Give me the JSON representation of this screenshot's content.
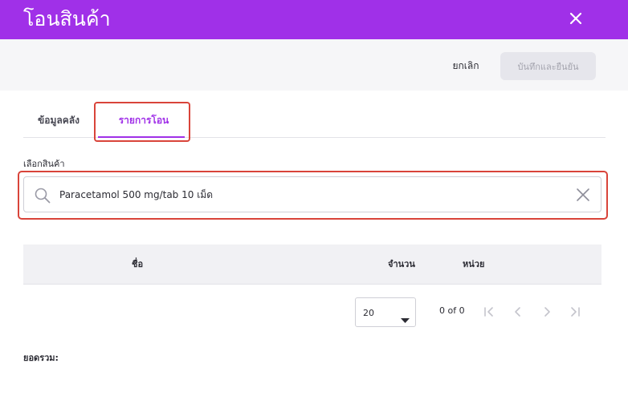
{
  "dialog": {
    "title": "โอนสินค้า"
  },
  "actions": {
    "cancel_label": "ยกเลิก",
    "save_label": "บันทึกและยืนยัน"
  },
  "tabs": [
    {
      "label": "ข้อมูลคลัง",
      "active": false
    },
    {
      "label": "รายการโอน",
      "active": true
    }
  ],
  "product_search": {
    "label": "เลือกสินค้า",
    "value": "Paracetamol 500 mg/tab 10 เม็ด"
  },
  "table": {
    "columns": [
      "ชื่อ",
      "จำนวน",
      "หน่วย"
    ],
    "rows": []
  },
  "pagination": {
    "page_size": "20",
    "range_text": "0 of 0"
  },
  "summary": {
    "total_label": "ยอดรวม:"
  },
  "colors": {
    "brand": "#a030e8",
    "highlight": "#d9443a"
  }
}
